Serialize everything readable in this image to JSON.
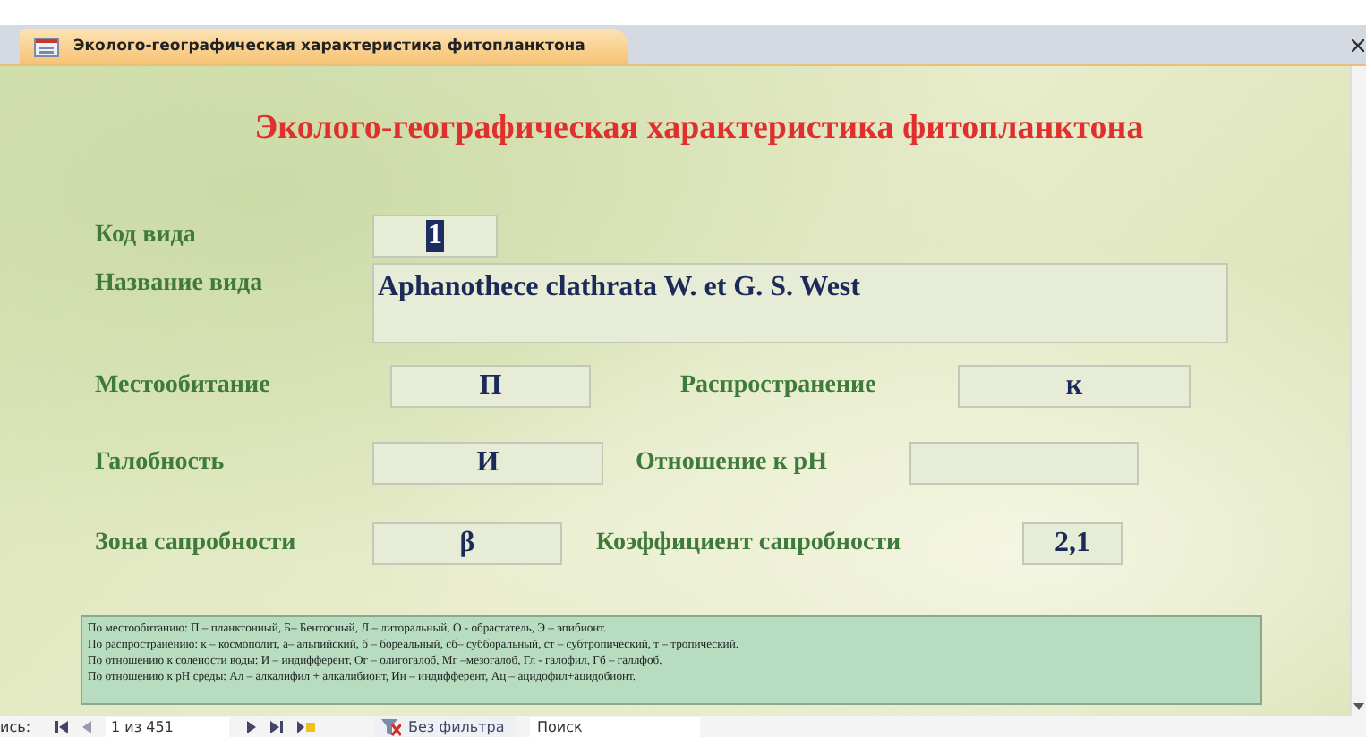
{
  "tab": {
    "title": "Эколого-географическая характеристика фитопланктона",
    "selected": true
  },
  "form": {
    "title": "Эколого-географическая характеристика фитопланктона",
    "fields": [
      {
        "label": "Код вида",
        "value": "1",
        "text_selected": true
      },
      {
        "label": "Название вида",
        "value": "Aphanothece clathrata W. et G. S. West"
      },
      {
        "label": "Местообитание",
        "value": "П"
      },
      {
        "label": "Распространение",
        "value": "к"
      },
      {
        "label": "Галобность",
        "value": "И"
      },
      {
        "label": "Отношение к pH"
      },
      {
        "label": "Зона сапробности",
        "value": "β"
      },
      {
        "label": "Коэффициент сапробности",
        "value": "2,1"
      }
    ],
    "legend": [
      "По местообитанию: П – планктонный, Б– Бентосный, Л – литоральный, О - обрастатель, Э – эпибионт.",
      "По распространению: к – космополит, а– альпийский, б – бореальный, сб– субборальный, ст – субтропический, т – тропический.",
      "По отношению к солености воды: И – индифферент, Ог – олигогалоб, Мг –мезогалоб, Гл - галофил, Гб – галлфоб.",
      "По отношению к pH среды: Ал – алкалифил + алкалибионт, Ин – индифферент, Ац – ацидофил+ацидобионт."
    ]
  },
  "status_bar": {
    "record_label": "ись:",
    "record": "1 из 451",
    "filter": "Без фильтра",
    "search_placeholder": "Поиск"
  }
}
